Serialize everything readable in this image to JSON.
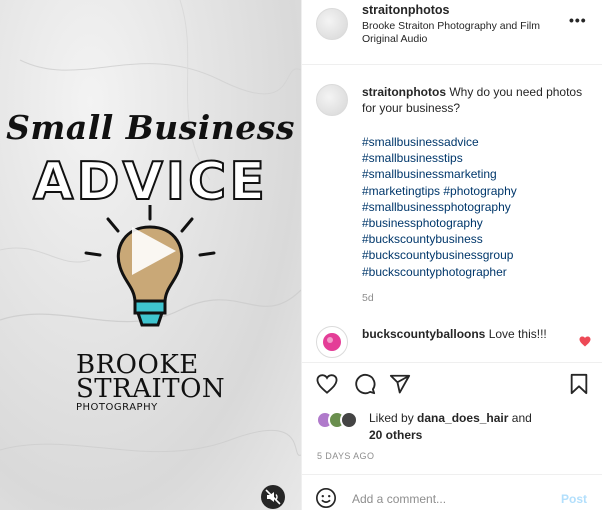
{
  "media": {
    "script_title": "Small Business",
    "headline": "ADVICE",
    "brand_line1": "BROOKE",
    "brand_line2": "STRAITON",
    "brand_line3": "PHOTOGRAPHY"
  },
  "header": {
    "username": "straitonphotos",
    "audio": "Brooke Straiton Photography and Film",
    "audio_sub": "Original Audio",
    "more_label": "•••"
  },
  "caption": {
    "username": "straitonphotos",
    "text": "Why do you need photos for your business?",
    "hashtags": [
      "#smallbusinessadvice",
      "#smallbusinesstips",
      "#smallbusinessmarketing",
      "#marketingtips #photography",
      "#smallbusinessphotography",
      "#businessphotography",
      "#buckscountybusiness",
      "#buckscountybusinessgroup",
      "#buckscountyphotographer"
    ],
    "age": "5d"
  },
  "comments": [
    {
      "username": "buckscountyballoons",
      "text": "Love this!!!"
    }
  ],
  "likes": {
    "prefix": "Liked by",
    "user": "dana_does_hair",
    "joiner": "and",
    "others": "20 others"
  },
  "timestamp": "5 DAYS AGO",
  "composer": {
    "placeholder": "Add a comment...",
    "post_label": "Post"
  },
  "icons": [
    "heart-icon",
    "comment-icon",
    "share-icon",
    "bookmark-icon",
    "emoji-icon",
    "mute-icon",
    "play-icon",
    "lightbulb-icon"
  ],
  "colors": {
    "link": "#00376b",
    "muted": "#8e8e8e",
    "post": "#b2dffc",
    "like": "#ed4956",
    "bulb": "#c9a877",
    "bulb_base": "#3fc4cf"
  }
}
